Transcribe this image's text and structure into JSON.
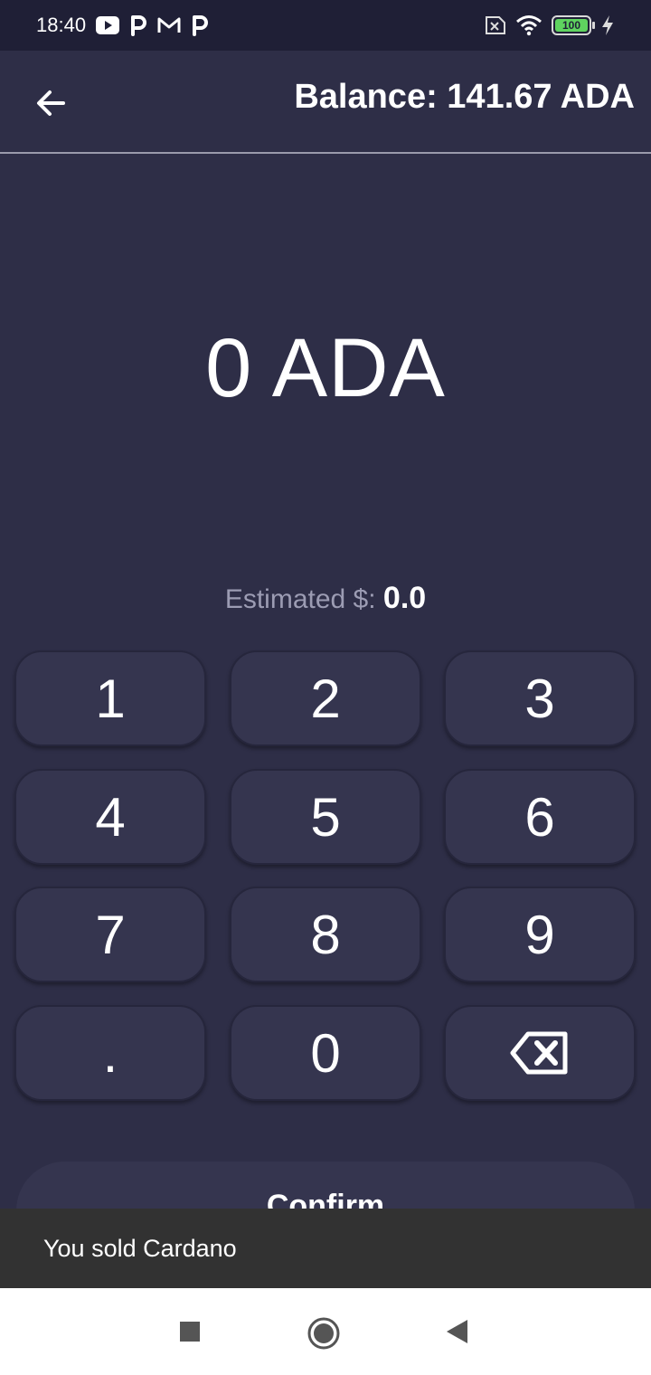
{
  "status_bar": {
    "time": "18:40",
    "battery_level": "100",
    "icons": [
      "youtube-icon",
      "p-app-icon",
      "gmail-icon",
      "p-app-icon",
      "sim-error-icon",
      "wifi-icon",
      "battery-icon",
      "charging-icon"
    ]
  },
  "header": {
    "back_icon": "arrow-left-icon",
    "balance": "Balance: 141.67 ADA"
  },
  "amount": {
    "display": "0 ADA"
  },
  "estimate": {
    "label": "Estimated $: ",
    "value": "0.0"
  },
  "keypad": {
    "keys": [
      "1",
      "2",
      "3",
      "4",
      "5",
      "6",
      "7",
      "8",
      "9",
      ".",
      "0"
    ],
    "backspace_icon": "backspace-icon"
  },
  "confirm": {
    "label": "Confirm"
  },
  "snackbar": {
    "message": "You sold Cardano"
  },
  "nav_bar": {
    "icons": [
      "recents-square-icon",
      "home-circle-icon",
      "back-triangle-icon"
    ]
  },
  "colors": {
    "background": "#2e2e47",
    "status_bar": "#1f1f36",
    "key": "#35354f",
    "snackbar": "#323232",
    "battery_green": "#5fd35f"
  }
}
